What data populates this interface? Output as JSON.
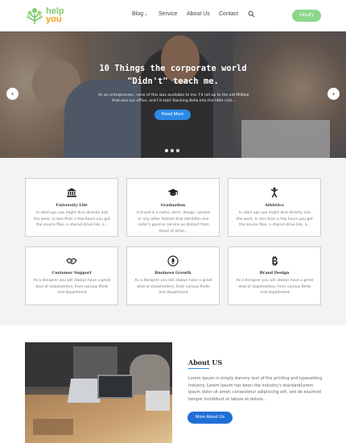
{
  "header": {
    "logo": {
      "line1": "help",
      "line2": "you"
    },
    "nav": [
      {
        "label": "Blog",
        "has_dropdown": true
      },
      {
        "label": "Service",
        "has_dropdown": false
      },
      {
        "label": "About Us",
        "has_dropdown": false
      },
      {
        "label": "Contact",
        "has_dropdown": false
      }
    ],
    "search_icon": "search-icon",
    "inquiry_label": "Inquiry",
    "colors": {
      "logo_green": "#7fcc6b",
      "logo_orange": "#f5a21b",
      "inquiry_bg": "#8bd68b"
    }
  },
  "hero": {
    "title": "10 Things the corporate world \"Didn't\" teach me.",
    "subtitle": "As an entrepreneur, none of this was available to me. I'd roll up to the old Milkbar that was our office, and I'd start Slacking Bella into the little visit...",
    "button_label": "Read More",
    "prev_icon": "chevron-left-icon",
    "next_icon": "chevron-right-icon",
    "slides": 3,
    "active_slide": 1,
    "button_color": "#2c8ae6"
  },
  "services": {
    "cards": [
      {
        "icon": "university-icon",
        "title": "University Life",
        "desc": "In start-ups you might dive directly into the work. In less than a few hours you get the source files, a shared drive link, a..."
      },
      {
        "icon": "graduation-cap-icon",
        "title": "Graduation",
        "desc": "A brand is a name, term, design, symbol or any other feature that identifies one seller's good or service as distinct from those of other..."
      },
      {
        "icon": "athlete-icon",
        "title": "Athletics",
        "desc": "In start-ups you might dive directly into the work. In less than a few hours you get the source files, a shared drive link, a..."
      },
      {
        "icon": "handshake-icon",
        "title": "Customer Support",
        "desc": "As a designer you will always have a great deal of stakeholders, from various fields and department"
      },
      {
        "icon": "rocket-icon",
        "title": "Business Growth",
        "desc": "As a designer you will always have a great deal of stakeholders, from various fields and department"
      },
      {
        "icon": "bitcoin-icon",
        "title": "Brand Design",
        "desc": "As a designer you will always have a great deal of stakeholders, from various fields and department"
      }
    ]
  },
  "about": {
    "title": "About US",
    "text": "Lorem Ipsum is simply dummy text of the printing and typesetting industry. Lorem Ipsum has been the industry's standardLorem ipsum dolor sit amet, consectetur adipisicing elit, sed do eiusmod tempor incididunt ut labore et dolore...",
    "button_label": "More About Us",
    "accent": "#1f6fd6"
  }
}
